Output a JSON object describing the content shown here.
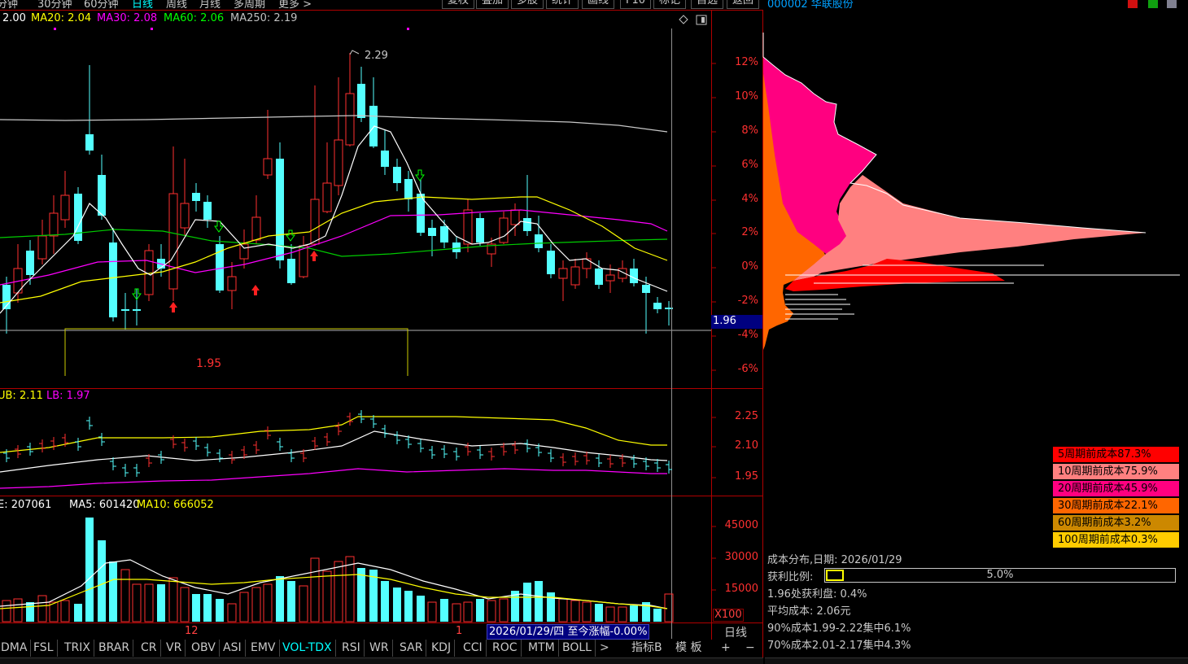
{
  "top_bar": {
    "periods": [
      "分钟",
      "30分钟",
      "60分钟",
      "日线",
      "周线",
      "月线",
      "多周期",
      "更多 >"
    ],
    "selected_period": "日线",
    "tools": [
      "复权",
      "叠加",
      "多股",
      "统计",
      "画线",
      "F10",
      "标记",
      "自选",
      "返回"
    ],
    "stock_title": "000002 华联股份"
  },
  "main_chart": {
    "ma_labels": [
      {
        "text": "2.00",
        "color": "#ffffff"
      },
      {
        "text": "MA20: 2.04",
        "color": "#ffff00"
      },
      {
        "text": "MA30: 2.08",
        "color": "#ff00ff"
      },
      {
        "text": "MA60: 2.06",
        "color": "#00ff00"
      },
      {
        "text": "MA250: 2.19",
        "color": "#c0c0c0"
      }
    ],
    "pct_ticks": [
      "12%",
      "10%",
      "8%",
      "6%",
      "4%",
      "2%",
      "0%",
      "-2%",
      "-4%",
      "-6%"
    ],
    "high_label": "2.29",
    "low_label": "1.95",
    "current_price": "1.96"
  },
  "boll_panel": {
    "labels": [
      {
        "text": "UB: 2.11",
        "color": "#ffff00"
      },
      {
        "text": "LB: 1.97",
        "color": "#ff00ff"
      }
    ],
    "ticks": [
      "2.25",
      "2.10",
      "1.95"
    ]
  },
  "volume_panel": {
    "labels": [
      {
        "text": "E: 207061",
        "color": "#ffffff"
      },
      {
        "text": "MA5: 601420",
        "color": "#ffffff"
      },
      {
        "text": "MA10: 666052",
        "color": "#ffff00"
      }
    ],
    "ticks": [
      "45000",
      "30000",
      "15000"
    ],
    "unit": "X100"
  },
  "time_axis": {
    "month_labels": [
      "12",
      "1"
    ],
    "date_box": "2026/01/29/四  至今涨幅-0.00%",
    "period_label": "日线"
  },
  "indicator_tabs": [
    "DMA",
    "FSL",
    "TRIX",
    "BRAR",
    "CR",
    "VR",
    "OBV",
    "ASI",
    "EMV",
    "VOL-TDX",
    "RSI",
    "WR",
    "SAR",
    "KDJ",
    "CCI",
    "ROC",
    "MTM",
    "BOLL",
    ">"
  ],
  "selected_indicator": "VOL-TDX",
  "bottom_right": {
    "zb": "指标B",
    "mb": "模 板",
    "plus": "+",
    "minus": "−"
  },
  "chip_legend": [
    {
      "text": "5周期前成本87.3%",
      "bg": "#ff0000",
      "fg": "#000000"
    },
    {
      "text": "10周期前成本75.9%",
      "bg": "#ff8080",
      "fg": "#000000"
    },
    {
      "text": "20周期前成本45.9%",
      "bg": "#ff0080",
      "fg": "#000000"
    },
    {
      "text": "30周期前成本22.1%",
      "bg": "#ff6600",
      "fg": "#000000"
    },
    {
      "text": "60周期前成本3.2%",
      "bg": "#cc8800",
      "fg": "#000000"
    },
    {
      "text": "100周期前成本0.3%",
      "bg": "#ffcc00",
      "fg": "#000000"
    }
  ],
  "chip_info": {
    "date_line": "成本分布,日期:  2026/01/29",
    "profit_label": "获利比例:",
    "profit_value": "5.0%",
    "profit_fraction": 0.05,
    "line1": "1.96处获利盘:  0.4%",
    "line2": "平均成本:  2.06元",
    "line3": "90%成本1.99-2.22集中6.1%",
    "line4": "70%成本2.01-2.17集中4.3%"
  }
}
